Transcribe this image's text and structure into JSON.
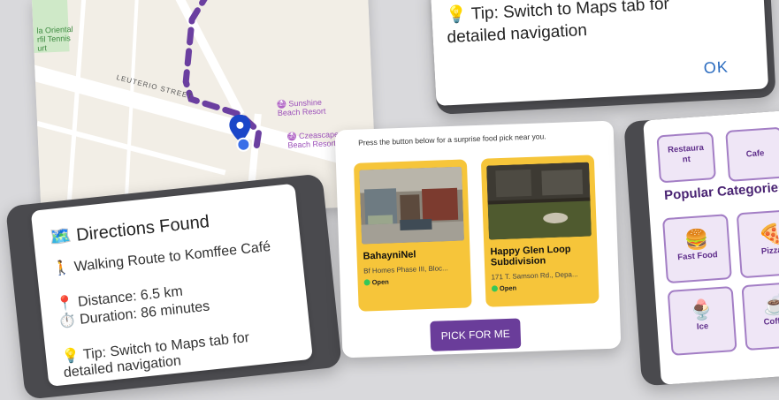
{
  "map": {
    "place_top_left": "la Oriental\nrfil Tennis\nurt",
    "street": "LEUTERIO STREET",
    "poi_1": "Sunshine\nBeach Resort",
    "poi_2": "Czeascape\nBeach Resort"
  },
  "tip_dialog": {
    "text": "Tip: Switch to Maps tab for detailed navigation",
    "ok_label": "OK"
  },
  "directions": {
    "title": "Directions Found",
    "route": "Walking Route to Komffee Café",
    "distance": "Distance: 6.5 km",
    "duration": "Duration: 86 minutes",
    "tip": "Tip: Switch to Maps tab for",
    "tip_cont": "detailed navigation"
  },
  "food": {
    "hint": "Press the button below for a surprise food pick near you.",
    "picks": [
      {
        "name": "BahayniNel",
        "address": "Bf Homes Phase III, Bloc...",
        "status": "Open"
      },
      {
        "name": "Happy Glen Loop Subdivision",
        "address": "171 T. Samson Rd., Depa...",
        "status": "Open"
      }
    ],
    "button": "PICK FOR ME"
  },
  "categories": {
    "top_tiles": [
      "Restaura\nnt",
      "Cafe"
    ],
    "title": "Popular Categories",
    "tiles": [
      "Fast Food",
      "Pizza",
      "Ice",
      "Coffee"
    ]
  },
  "colors": {
    "accent_purple": "#6a3d9a",
    "card_yellow": "#f6c53a",
    "open_green": "#34c759",
    "ok_blue": "#2a6bbf"
  }
}
